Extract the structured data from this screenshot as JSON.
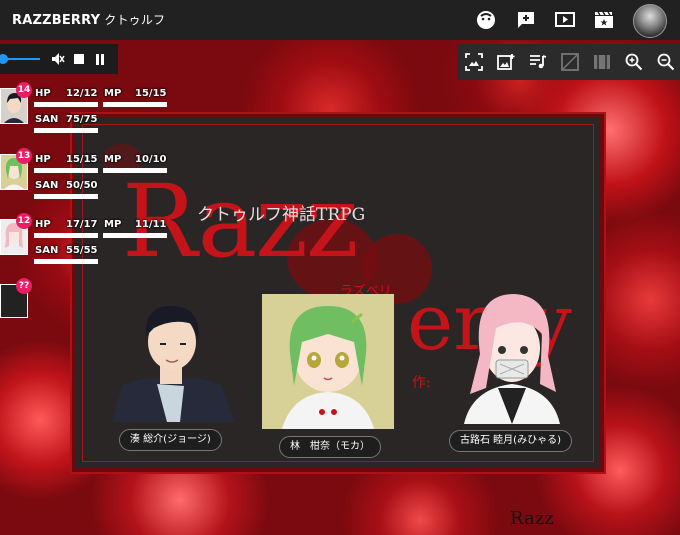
{
  "app": {
    "brand": "RAZZBERRY",
    "room_name": "クトゥルフ"
  },
  "topbar_icons": [
    "face-icon",
    "add-chat-icon",
    "video-icon",
    "clapperboard-icon"
  ],
  "audio_controls": {
    "mute": "mute-icon",
    "stop": "stop-icon",
    "pause": "pause-icon"
  },
  "toolbar_icons": [
    "screenshot-icon",
    "add-image-icon",
    "playlist-icon",
    "layer-icon",
    "film-icon",
    "zoom-in-icon",
    "zoom-out-icon"
  ],
  "board": {
    "subtitle": "クトゥルフ神話TRPG",
    "title_top": "Razz",
    "title_bottom": "erry",
    "kana": "ラズベリ",
    "author": "作:",
    "portraits": [
      {
        "name": "湊 総介(ジョージ)"
      },
      {
        "name": "林　柑奈（モカ）"
      },
      {
        "name": "古路石 睦月(みひゃる)"
      }
    ]
  },
  "characters": [
    {
      "badge": "14",
      "hp_label": "HP",
      "hp": "12/12",
      "mp_label": "MP",
      "mp": "15/15",
      "san_label": "SAN",
      "san": "75/75",
      "hp_fill": 1.0,
      "mp_fill": 1.0,
      "san_fill": 1.0
    },
    {
      "badge": "13",
      "hp_label": "HP",
      "hp": "15/15",
      "mp_label": "MP",
      "mp": "10/10",
      "san_label": "SAN",
      "san": "50/50",
      "hp_fill": 1.0,
      "mp_fill": 1.0,
      "san_fill": 1.0
    },
    {
      "badge": "12",
      "hp_label": "HP",
      "hp": "17/17",
      "mp_label": "MP",
      "mp": "11/11",
      "san_label": "SAN",
      "san": "55/55",
      "hp_fill": 1.0,
      "mp_fill": 1.0,
      "san_fill": 1.0
    }
  ],
  "unknown_character": {
    "badge": "??"
  },
  "background_text": "Razz",
  "colors": {
    "accent": "#e91e63",
    "board_red": "#c4141a",
    "topbar": "#212121",
    "slider": "#2196f3"
  }
}
